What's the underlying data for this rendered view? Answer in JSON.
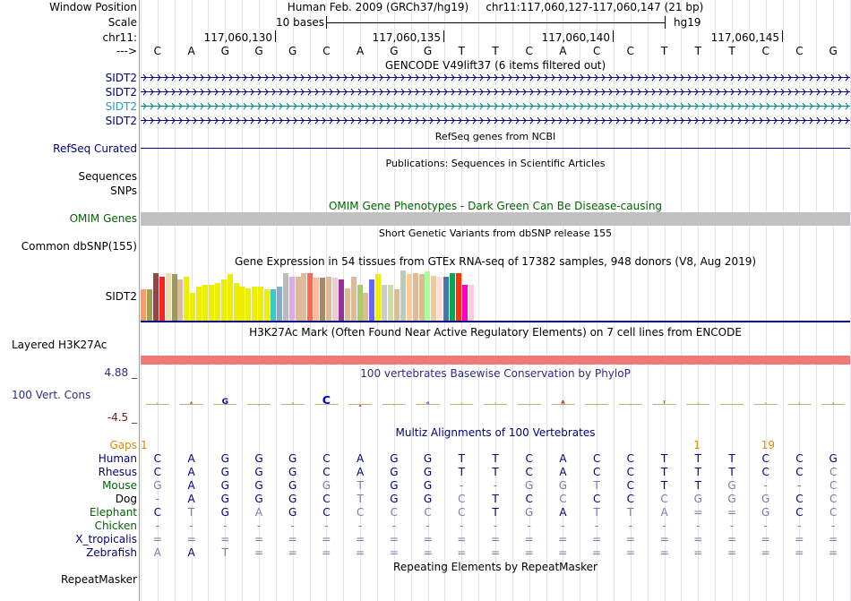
{
  "labels": {
    "window_position": "Window Position",
    "scale": "Scale",
    "chrom": "chr11:",
    "strand_arrow": "--->",
    "gene_rows": [
      "SIDT2",
      "SIDT2",
      "SIDT2",
      "SIDT2"
    ],
    "refseq": "RefSeq Curated",
    "sequences": "Sequences",
    "snps": "SNPs",
    "omim": "OMIM Genes",
    "dbsnp": "Common dbSNP(155)",
    "gtex_gene": "SIDT2",
    "h3k27ac": "Layered H3K27Ac",
    "phylop_max": "4.88 _",
    "phylop_label": "100 Vert. Cons",
    "phylop_min": "-4.5 _",
    "gaps": "Gaps",
    "species": [
      "Human",
      "Rhesus",
      "Mouse",
      "Dog",
      "Elephant",
      "Chicken",
      "X_tropicalis",
      "Zebrafish"
    ],
    "repeatmasker": "RepeatMasker"
  },
  "header": {
    "assembly": "Human Feb. 2009 (GRCh37/hg19)",
    "position": "chr11:117,060,127-117,060,147 (21 bp)",
    "scale_text": "10 bases",
    "scale_assembly": "hg19",
    "coords": [
      "117,060,130",
      "117,060,135",
      "117,060,140",
      "117,060,145"
    ]
  },
  "reference_bases": [
    "C",
    "A",
    "G",
    "G",
    "G",
    "C",
    "A",
    "G",
    "G",
    "T",
    "T",
    "C",
    "A",
    "C",
    "C",
    "T",
    "T",
    "T",
    "C",
    "C",
    "G"
  ],
  "track_titles": {
    "gencode": "GENCODE V49lift37 (6 items filtered out)",
    "refseq": "RefSeq genes from NCBI",
    "publications": "Publications: Sequences in Scientific Articles",
    "omim": "OMIM Gene Phenotypes - Dark Green Can Be Disease-causing",
    "dbsnp": "Short Genetic Variants from dbSNP release 155",
    "gtex": "Gene Expression in 54 tissues from GTEx RNA-seq of 17382 samples, 948 donors (V8, Aug 2019)",
    "h3k27ac": "H3K27Ac Mark (Often Found Near Active Regulatory Elements) on 7 cell lines from ENCODE",
    "phylop": "100 vertebrates Basewise Conservation by PhyloP",
    "multiz": "Multiz Alignments of 100 Vertebrates",
    "repeatmasker": "Repeating Elements by RepeatMasker"
  },
  "gaps_marks": [
    {
      "col": 0,
      "text": "1"
    },
    {
      "col": 16,
      "text": "1"
    },
    {
      "col": 18,
      "text": "19"
    }
  ],
  "alignment": {
    "Human": "CAGGGCAGGTTCACCTTTCCG",
    "Rhesus": "CAGGGCAGGTTCACCTTTCCC",
    "Mouse": "GAGGGGTGG--GGTCTTG--C",
    "Dog": "-AGGGCTGGCTCCCCCGGGCC",
    "Elephant": "CTGAGCCCCCTGATTA==GCC",
    "Chicken": "---------------------",
    "X_tropicalis": "=====================",
    "Zebrafish": "AAT=================="
  },
  "gtex_values": [
    0.62,
    0.62,
    0.95,
    0.88,
    0.95,
    0.92,
    0.82,
    0.88,
    0.55,
    0.68,
    0.72,
    0.72,
    0.75,
    0.82,
    0.92,
    0.75,
    0.68,
    0.65,
    0.68,
    0.68,
    0.62,
    0.62,
    0.68,
    0.95,
    0.88,
    0.88,
    0.95,
    0.95,
    0.85,
    0.85,
    0.88,
    0.85,
    0.82,
    0.65,
    0.88,
    0.72,
    0.55,
    0.82,
    0.92,
    0.72,
    0.72,
    0.62,
    1.0,
    0.92,
    0.95,
    0.92,
    0.98,
    0.9,
    0.88,
    0.88,
    0.95,
    0.95,
    0.72,
    0.72
  ],
  "gtex_colors": [
    "#ff9966",
    "#a0a050",
    "#994444",
    "#ff2222",
    "#eeddaa",
    "#999966",
    "#ddbb99",
    "#eeee00",
    "#eeee00",
    "#eeee00",
    "#eeee00",
    "#eeee00",
    "#eeee00",
    "#eeee00",
    "#eeee00",
    "#eeee00",
    "#eeee00",
    "#eeee00",
    "#eeee00",
    "#eeee00",
    "#eeee00",
    "#33cccc",
    "#88aacc",
    "#bbbbbb",
    "#ddaaee",
    "#ddbb99",
    "#ddbb99",
    "#ff6655",
    "#ffbb99",
    "#aa8866",
    "#ddbb99",
    "#eecccc",
    "#993399",
    "#ddbb99",
    "#ddbb99",
    "#aacc66",
    "#ddbb99",
    "#6666ff",
    "#eeee00",
    "#cccccc",
    "#ccddaa",
    "#ddbb99",
    "#bbccbb",
    "#ffcc99",
    "#ddbb99",
    "#ddbb99",
    "#aaff99",
    "#eecc99",
    "#ffdddd",
    "#4477aa",
    "#00aa55",
    "#ff3300",
    "#ff00cc",
    "#ffccdd"
  ],
  "colors": {
    "track_blue": "#000080",
    "omim_green": "#006400",
    "omim_bar": "#c0c0c0",
    "h3k27ac_bar": "#f07878",
    "gaps_orange": "#e08a00",
    "gencode_selected": "#008080",
    "species_green": "#006400",
    "species_blue": "#000080"
  }
}
